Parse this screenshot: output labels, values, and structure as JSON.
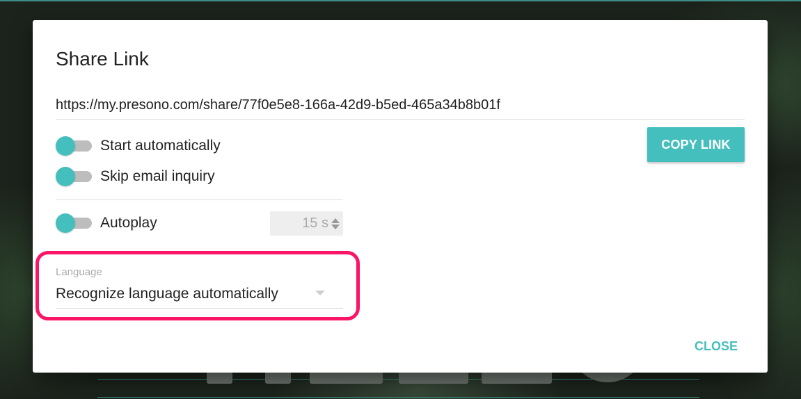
{
  "dialog": {
    "title": "Share Link",
    "share_url": "https://my.presono.com/share/77f0e5e8-166a-42d9-b5ed-465a34b8b01f",
    "copy_button_label": "COPY LINK",
    "close_button_label": "CLOSE"
  },
  "toggles": {
    "start_automatically": {
      "label": "Start automatically",
      "on": true
    },
    "skip_email_inquiry": {
      "label": "Skip email inquiry",
      "on": true
    },
    "autoplay": {
      "label": "Autoplay",
      "on": true
    }
  },
  "autoplay_interval": {
    "value": "15 s"
  },
  "language": {
    "label": "Language",
    "selected": "Recognize language automatically"
  },
  "colors": {
    "accent": "#45bfbd",
    "highlight": "#fb1567",
    "track": "#bdbdbd"
  },
  "icons": {
    "stepper": "up-down-arrows-icon",
    "dropdown": "caret-down-icon"
  }
}
